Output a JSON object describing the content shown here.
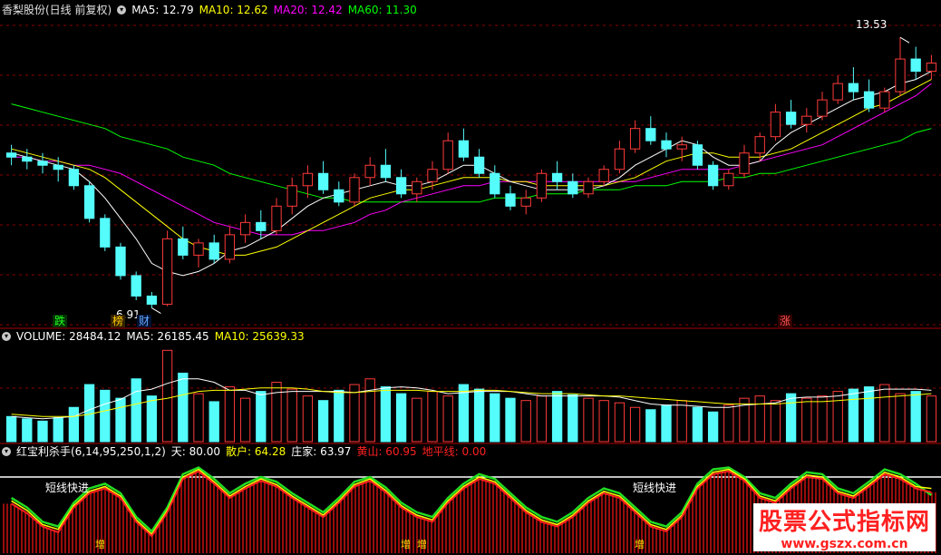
{
  "header1": {
    "stock": "香梨股份(日线 前复权)",
    "ma5": "MA5: 12.79",
    "ma10": "MA10: 12.62",
    "ma20": "MA20: 12.42",
    "ma60": "MA60: 11.30"
  },
  "header2": {
    "volume": "VOLUME: 28484.12",
    "ma5": "MA5: 26185.45",
    "ma10": "MA10: 25639.33"
  },
  "header3": {
    "name": "红宝利杀手(6,14,95,250,1,2)",
    "tian": "天: 80.00",
    "sanhu": "散户: 64.28",
    "zhuangjia": "庄家: 63.97",
    "huangshan": "黄山: 60.95",
    "dipingxian": "地平线: 0.00"
  },
  "annotations": {
    "high": "13.53",
    "low": "6.91",
    "marker_die": "跌",
    "marker_bang": "榜",
    "marker_cai": "财",
    "marker_zhang": "涨",
    "short_1": "短线快进",
    "short_2": "短线快进",
    "zeng": "增"
  },
  "watermark": {
    "line1": "股票公式指标网",
    "line2": "www.gszx.com.cn"
  },
  "colors": {
    "up": "#ff3a3a",
    "down": "#54fcfc",
    "ma5": "#ffffff",
    "ma10": "#ffff00",
    "ma20": "#ff00ff",
    "ma60": "#00ff00",
    "grid": "#8b0000",
    "sanhu": "#ffff00",
    "zhuangjia": "#ff2020",
    "huangshan": "#22dd22"
  },
  "chart_data": {
    "type": "candlestick",
    "price": {
      "ylim": [
        6.5,
        14.0
      ],
      "annotations": {
        "high": 13.53,
        "low": 6.91
      },
      "ohlc": [
        [
          10.7,
          10.9,
          10.4,
          10.6
        ],
        [
          10.6,
          10.8,
          10.3,
          10.5
        ],
        [
          10.5,
          10.7,
          10.2,
          10.4
        ],
        [
          10.4,
          10.6,
          10.0,
          10.3
        ],
        [
          10.3,
          10.4,
          9.8,
          9.9
        ],
        [
          9.9,
          10.0,
          9.0,
          9.1
        ],
        [
          9.1,
          9.2,
          8.3,
          8.4
        ],
        [
          8.4,
          8.5,
          7.6,
          7.7
        ],
        [
          7.7,
          7.8,
          7.1,
          7.2
        ],
        [
          7.2,
          7.3,
          6.91,
          7.0
        ],
        [
          7.0,
          8.8,
          6.95,
          8.6
        ],
        [
          8.6,
          8.9,
          8.1,
          8.2
        ],
        [
          8.2,
          8.6,
          7.9,
          8.5
        ],
        [
          8.5,
          8.7,
          8.0,
          8.1
        ],
        [
          8.1,
          8.9,
          8.0,
          8.7
        ],
        [
          8.7,
          9.2,
          8.5,
          9.0
        ],
        [
          9.0,
          9.3,
          8.6,
          8.8
        ],
        [
          8.8,
          9.6,
          8.7,
          9.4
        ],
        [
          9.4,
          10.1,
          9.2,
          9.9
        ],
        [
          9.9,
          10.4,
          9.6,
          10.2
        ],
        [
          10.2,
          10.5,
          9.7,
          9.8
        ],
        [
          9.8,
          10.0,
          9.4,
          9.5
        ],
        [
          9.5,
          10.2,
          9.4,
          10.1
        ],
        [
          10.1,
          10.6,
          9.9,
          10.4
        ],
        [
          10.4,
          10.8,
          10.0,
          10.1
        ],
        [
          10.1,
          10.3,
          9.6,
          9.7
        ],
        [
          9.7,
          10.1,
          9.5,
          10.0
        ],
        [
          10.0,
          10.5,
          9.8,
          10.3
        ],
        [
          10.3,
          11.2,
          10.2,
          11.0
        ],
        [
          11.0,
          11.3,
          10.5,
          10.6
        ],
        [
          10.6,
          10.8,
          10.1,
          10.2
        ],
        [
          10.2,
          10.4,
          9.6,
          9.7
        ],
        [
          9.7,
          9.9,
          9.3,
          9.4
        ],
        [
          9.4,
          9.8,
          9.2,
          9.6
        ],
        [
          9.6,
          10.3,
          9.5,
          10.2
        ],
        [
          10.2,
          10.5,
          9.8,
          10.0
        ],
        [
          10.0,
          10.2,
          9.6,
          9.7
        ],
        [
          9.7,
          10.1,
          9.6,
          10.0
        ],
        [
          10.0,
          10.4,
          9.9,
          10.3
        ],
        [
          10.3,
          11.0,
          10.2,
          10.8
        ],
        [
          10.8,
          11.5,
          10.7,
          11.3
        ],
        [
          11.3,
          11.6,
          10.9,
          11.0
        ],
        [
          11.0,
          11.2,
          10.6,
          10.8
        ],
        [
          10.8,
          11.1,
          10.5,
          10.9
        ],
        [
          10.9,
          11.0,
          10.3,
          10.4
        ],
        [
          10.4,
          10.5,
          9.8,
          9.9
        ],
        [
          9.9,
          10.3,
          9.8,
          10.2
        ],
        [
          10.2,
          10.9,
          10.1,
          10.7
        ],
        [
          10.7,
          11.2,
          10.5,
          11.1
        ],
        [
          11.1,
          11.9,
          11.0,
          11.7
        ],
        [
          11.7,
          12.0,
          11.3,
          11.4
        ],
        [
          11.4,
          11.8,
          11.2,
          11.6
        ],
        [
          11.6,
          12.2,
          11.5,
          12.0
        ],
        [
          12.0,
          12.6,
          11.9,
          12.4
        ],
        [
          12.4,
          12.8,
          12.0,
          12.2
        ],
        [
          12.2,
          12.5,
          11.7,
          11.8
        ],
        [
          11.8,
          12.3,
          11.7,
          12.2
        ],
        [
          12.2,
          13.53,
          12.1,
          13.0
        ],
        [
          13.0,
          13.3,
          12.5,
          12.7
        ],
        [
          12.7,
          13.1,
          12.5,
          12.9
        ]
      ],
      "ma5": [
        10.7,
        10.6,
        10.5,
        10.4,
        10.3,
        10.0,
        9.6,
        9.1,
        8.6,
        8.0,
        7.8,
        7.7,
        7.8,
        8.0,
        8.3,
        8.4,
        8.6,
        8.8,
        9.1,
        9.4,
        9.6,
        9.7,
        9.8,
        9.9,
        10.0,
        9.9,
        9.9,
        10.0,
        10.2,
        10.4,
        10.4,
        10.2,
        10.0,
        9.9,
        9.8,
        9.8,
        9.8,
        9.8,
        9.9,
        10.1,
        10.4,
        10.6,
        10.8,
        11.0,
        10.9,
        10.6,
        10.4,
        10.4,
        10.5,
        10.9,
        11.2,
        11.4,
        11.6,
        11.8,
        12.0,
        12.1,
        12.2,
        12.4,
        12.5,
        12.7
      ],
      "ma10": [
        10.8,
        10.7,
        10.6,
        10.5,
        10.4,
        10.3,
        10.1,
        9.8,
        9.5,
        9.2,
        8.9,
        8.6,
        8.4,
        8.3,
        8.2,
        8.2,
        8.3,
        8.4,
        8.6,
        8.8,
        9.0,
        9.2,
        9.4,
        9.6,
        9.7,
        9.8,
        9.8,
        9.9,
        10.0,
        10.1,
        10.1,
        10.1,
        10.0,
        10.0,
        9.9,
        9.9,
        9.9,
        9.9,
        9.9,
        10.0,
        10.1,
        10.3,
        10.5,
        10.6,
        10.7,
        10.7,
        10.6,
        10.6,
        10.6,
        10.7,
        10.8,
        11.0,
        11.2,
        11.4,
        11.6,
        11.8,
        11.9,
        12.1,
        12.3,
        12.5
      ],
      "ma20": [
        10.6,
        10.6,
        10.5,
        10.5,
        10.4,
        10.4,
        10.3,
        10.2,
        10.0,
        9.8,
        9.6,
        9.4,
        9.2,
        9.0,
        8.9,
        8.8,
        8.7,
        8.7,
        8.7,
        8.8,
        8.8,
        8.9,
        9.0,
        9.2,
        9.3,
        9.5,
        9.6,
        9.7,
        9.8,
        9.9,
        9.9,
        10.0,
        10.0,
        10.0,
        10.0,
        10.0,
        10.0,
        10.0,
        10.0,
        10.0,
        10.0,
        10.1,
        10.2,
        10.3,
        10.3,
        10.3,
        10.3,
        10.4,
        10.5,
        10.6,
        10.7,
        10.8,
        10.9,
        11.1,
        11.3,
        11.5,
        11.7,
        11.9,
        12.1,
        12.4
      ],
      "ma60": [
        11.9,
        11.8,
        11.7,
        11.6,
        11.5,
        11.4,
        11.3,
        11.1,
        11.0,
        10.9,
        10.8,
        10.6,
        10.5,
        10.4,
        10.2,
        10.1,
        10.0,
        9.9,
        9.8,
        9.7,
        9.6,
        9.6,
        9.5,
        9.5,
        9.5,
        9.5,
        9.5,
        9.5,
        9.5,
        9.5,
        9.5,
        9.6,
        9.6,
        9.6,
        9.7,
        9.7,
        9.7,
        9.8,
        9.8,
        9.8,
        9.9,
        9.9,
        9.9,
        10.0,
        10.0,
        10.0,
        10.1,
        10.1,
        10.2,
        10.2,
        10.3,
        10.4,
        10.5,
        10.6,
        10.7,
        10.8,
        10.9,
        11.0,
        11.2,
        11.3
      ]
    },
    "volume": {
      "values": [
        22,
        20,
        18,
        21,
        30,
        50,
        45,
        38,
        55,
        40,
        80,
        60,
        42,
        35,
        48,
        38,
        44,
        52,
        46,
        40,
        36,
        45,
        50,
        55,
        48,
        42,
        38,
        44,
        40,
        50,
        46,
        42,
        38,
        36,
        40,
        44,
        41,
        38,
        36,
        34,
        30,
        28,
        32,
        36,
        30,
        26,
        32,
        38,
        40,
        36,
        42,
        38,
        40,
        44,
        46,
        48,
        50,
        42,
        44,
        40
      ],
      "ma5": [
        22,
        21,
        20,
        21,
        22,
        28,
        33,
        37,
        44,
        46,
        51,
        55,
        55,
        52,
        45,
        45,
        41,
        43,
        44,
        44,
        44,
        44,
        43,
        45,
        47,
        48,
        47,
        45,
        42,
        43,
        44,
        44,
        44,
        42,
        40,
        40,
        40,
        40,
        40,
        39,
        36,
        33,
        32,
        32,
        31,
        30,
        30,
        32,
        33,
        34,
        38,
        39,
        39,
        40,
        42,
        44,
        46,
        46,
        46,
        45
      ],
      "ma10": [
        24,
        23,
        22,
        22,
        22,
        24,
        27,
        30,
        33,
        36,
        38,
        41,
        44,
        45,
        45,
        46,
        47,
        47,
        47,
        46,
        44,
        43,
        43,
        44,
        45,
        45,
        45,
        44,
        44,
        44,
        45,
        45,
        44,
        43,
        42,
        42,
        42,
        41,
        40,
        40,
        39,
        38,
        37,
        36,
        35,
        34,
        33,
        33,
        33,
        33,
        34,
        35,
        35,
        36,
        37,
        38,
        39,
        40,
        41,
        42
      ]
    },
    "indicator": {
      "ylim": [
        0,
        100
      ],
      "tian": 80.0,
      "sanhu": [
        55,
        45,
        30,
        25,
        50,
        65,
        70,
        60,
        35,
        20,
        45,
        80,
        88,
        75,
        60,
        70,
        78,
        72,
        60,
        50,
        40,
        55,
        72,
        78,
        66,
        50,
        40,
        35,
        55,
        70,
        80,
        75,
        60,
        45,
        35,
        30,
        40,
        55,
        65,
        60,
        45,
        30,
        25,
        40,
        70,
        85,
        88,
        78,
        60,
        55,
        70,
        82,
        80,
        65,
        60,
        72,
        85,
        80,
        70,
        68
      ],
      "zhuangjia": [
        52,
        42,
        28,
        22,
        48,
        63,
        68,
        58,
        33,
        18,
        43,
        78,
        86,
        73,
        58,
        68,
        76,
        70,
        58,
        48,
        38,
        53,
        70,
        76,
        64,
        48,
        38,
        33,
        53,
        68,
        78,
        73,
        58,
        43,
        33,
        28,
        38,
        53,
        63,
        58,
        43,
        28,
        23,
        38,
        68,
        83,
        86,
        76,
        58,
        53,
        68,
        80,
        78,
        63,
        58,
        70,
        83,
        78,
        68,
        64
      ],
      "huangshan": [
        58,
        48,
        33,
        28,
        53,
        68,
        73,
        63,
        38,
        23,
        48,
        83,
        90,
        78,
        63,
        73,
        80,
        75,
        63,
        53,
        43,
        58,
        75,
        80,
        69,
        53,
        43,
        38,
        58,
        73,
        83,
        78,
        63,
        48,
        38,
        33,
        43,
        58,
        68,
        63,
        48,
        33,
        28,
        43,
        73,
        88,
        90,
        80,
        63,
        58,
        73,
        85,
        83,
        68,
        63,
        75,
        88,
        83,
        73,
        61
      ],
      "dipingxian": 0.0
    }
  }
}
